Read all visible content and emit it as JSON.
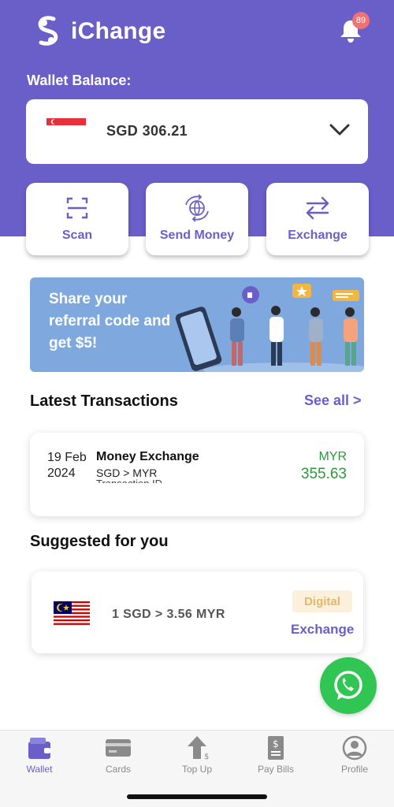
{
  "app": {
    "name": "iChange"
  },
  "notifications": {
    "count": "89"
  },
  "wallet": {
    "label": "Wallet Balance:",
    "balance_text": "SGD  306.21"
  },
  "actions": [
    {
      "label": "Scan",
      "icon": "scan-icon"
    },
    {
      "label": "Send Money",
      "icon": "globe-send-icon"
    },
    {
      "label": "Exchange",
      "icon": "exchange-arrows-icon"
    }
  ],
  "banner": {
    "text": "Share your referral code and get $5!"
  },
  "latest_transactions": {
    "title": "Latest Transactions",
    "see_all": "See all >",
    "items": [
      {
        "date": "19 Feb 2024",
        "title": "Money Exchange",
        "subtitle": "SGD > MYR",
        "subtitle_cut": "Transaction ID",
        "currency": "MYR",
        "amount": "355.63"
      }
    ]
  },
  "suggested": {
    "title": "Suggested for you",
    "items": [
      {
        "rate": "1 SGD >  3.56 MYR",
        "tag": "Digital",
        "tag_sub": "Exchange"
      }
    ]
  },
  "bottom_nav": [
    {
      "label": "Wallet",
      "icon": "wallet-icon",
      "active": true
    },
    {
      "label": "Cards",
      "icon": "card-icon"
    },
    {
      "label": "Top Up",
      "icon": "top-up-icon"
    },
    {
      "label": "Pay Bills",
      "icon": "bill-icon"
    },
    {
      "label": "Profile",
      "icon": "profile-icon"
    }
  ],
  "colors": {
    "brand": "#6a5fc9",
    "success": "#2a9a3a",
    "whatsapp": "#31c553",
    "badge": "#f07272"
  }
}
